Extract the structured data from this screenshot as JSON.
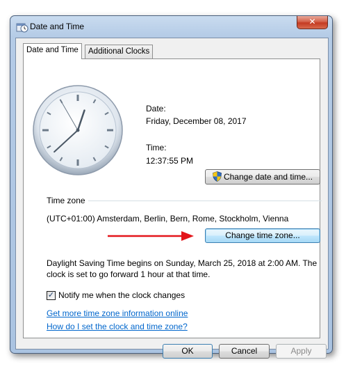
{
  "window": {
    "title": "Date and Time",
    "close_glyph": "✕"
  },
  "tabs": [
    {
      "label": "Date and Time",
      "active": true
    },
    {
      "label": "Additional Clocks",
      "active": false
    }
  ],
  "datetime": {
    "date_label": "Date:",
    "date_value": "Friday, December 08, 2017",
    "time_label": "Time:",
    "time_value": "12:37:55 PM",
    "change_button": "Change date and time..."
  },
  "clock": {
    "hours": 12,
    "minutes": 37,
    "seconds": 55
  },
  "timezone": {
    "group_label": "Time zone",
    "value": "(UTC+01:00) Amsterdam, Berlin, Bern, Rome, Stockholm, Vienna",
    "change_button": "Change time zone..."
  },
  "dst": {
    "line1": "Daylight Saving Time begins on Sunday, March 25, 2018 at 2:00 AM. The",
    "line2": "clock is set to go forward 1 hour at that time."
  },
  "notify": {
    "label": "Notify me when the clock changes",
    "checked": true,
    "check_glyph": "✓"
  },
  "links": {
    "more_info": "Get more time zone information online",
    "how_to": "How do I set the clock and time zone?"
  },
  "footer": {
    "ok": "OK",
    "cancel": "Cancel",
    "apply": "Apply"
  },
  "colors": {
    "link": "#0066cc",
    "annotation_arrow": "#e3151a",
    "shield_blue": "#2f6fc0",
    "shield_yellow": "#f3c613"
  },
  "icons": {
    "title": "date-time-icon",
    "shield": "uac-shield-icon",
    "arrow": "red-annotation-arrow"
  }
}
